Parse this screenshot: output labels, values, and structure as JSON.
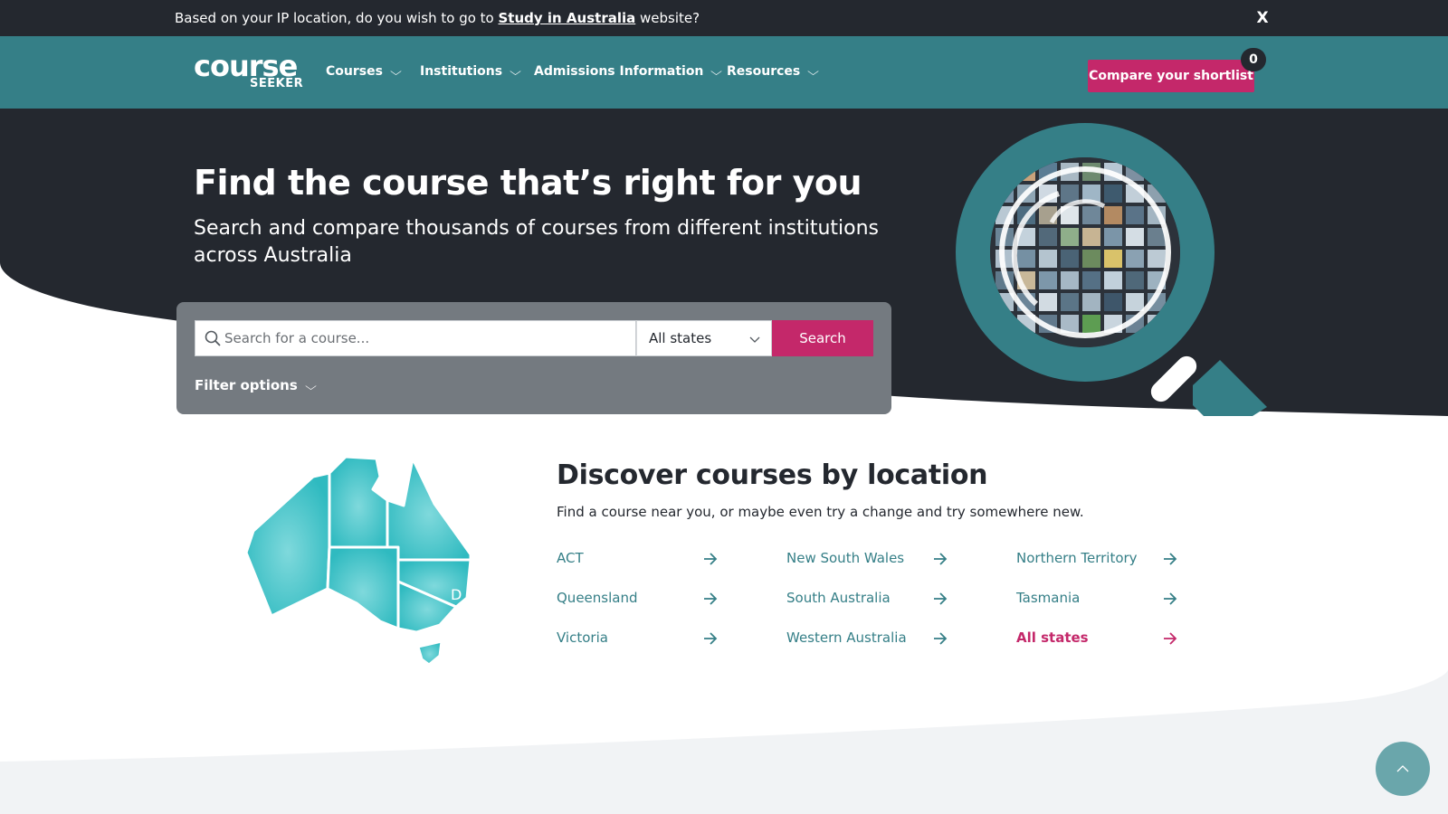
{
  "notice": {
    "text_before": "Based on your IP location, do you wish to go to ",
    "link_label": "Study in Australia",
    "text_after": " website?",
    "close_label": "X"
  },
  "nav": {
    "logo_main": "course",
    "logo_sub": "SEEKER",
    "items": [
      {
        "label": "Courses"
      },
      {
        "label": "Institutions"
      },
      {
        "label": "Admissions Information"
      },
      {
        "label": "Resources"
      }
    ],
    "shortlist_label": "Compare your shortlist",
    "shortlist_count": "0"
  },
  "hero": {
    "title": "Find the course that’s right for you",
    "subtitle": "Search and compare thousands of courses from different institutions across Australia"
  },
  "search": {
    "placeholder": "Search for a course...",
    "state_value": "All states",
    "button_label": "Search",
    "filter_label": "Filter options"
  },
  "discover": {
    "title": "Discover courses by location",
    "subtitle": "Find a course near you, or maybe even try a change and try somewhere new.",
    "locations": [
      {
        "label": "ACT"
      },
      {
        "label": "New South Wales"
      },
      {
        "label": "Northern Territory"
      },
      {
        "label": "Queensland"
      },
      {
        "label": "South Australia"
      },
      {
        "label": "Tasmania"
      },
      {
        "label": "Victoria"
      },
      {
        "label": "Western Australia"
      },
      {
        "label": "All states"
      }
    ],
    "map_label": "D"
  },
  "colors": {
    "dark": "#24282f",
    "teal": "#357f87",
    "pink": "#c4286a",
    "map_teal": "#3fbfc4",
    "panel_grey": "#747a80"
  },
  "icons": {
    "close": "close-icon",
    "search": "search-icon",
    "chevron": "chevron-down-icon",
    "arrow": "arrow-right-icon",
    "scroll_top": "chevron-up-icon"
  }
}
